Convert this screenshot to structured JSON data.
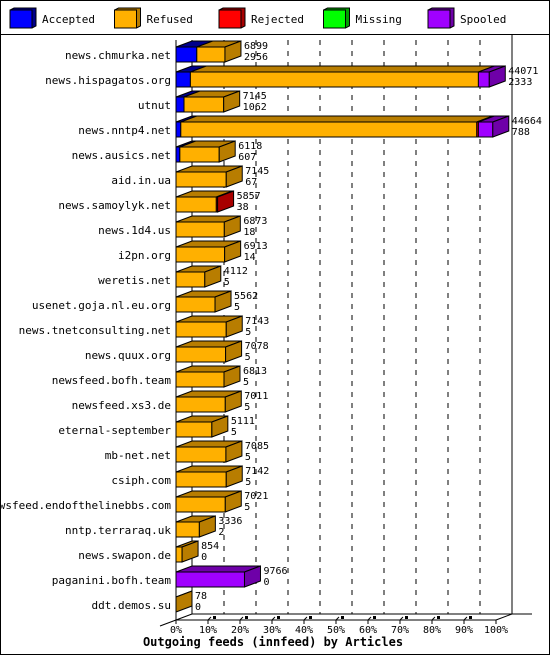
{
  "chart_data": {
    "type": "bar",
    "orientation": "horizontal",
    "stacked": true,
    "style": "3d",
    "title": "",
    "xlabel": "Outgoing feeds (innfeed) by Articles",
    "ylabel": "",
    "xlim": [
      0,
      100
    ],
    "x_ticks": [
      "0%",
      "10%",
      "20%",
      "30%",
      "40%",
      "50%",
      "60%",
      "70%",
      "80%",
      "90%",
      "100%"
    ],
    "grid": "vertical dashed",
    "legend_position": "top",
    "legend": [
      {
        "name": "Accepted",
        "color": "#0000ff",
        "side": "#00008b"
      },
      {
        "name": "Refused",
        "color": "#ffb000",
        "side": "#b87d00"
      },
      {
        "name": "Rejected",
        "color": "#ff0000",
        "side": "#a80000"
      },
      {
        "name": "Missing",
        "color": "#00ff00",
        "side": "#00a000"
      },
      {
        "name": "Spooled",
        "color": "#a000ff",
        "side": "#6e00a8"
      }
    ],
    "categories": [
      "news.chmurka.net",
      "news.hispagatos.org",
      "utnut",
      "news.nntp4.net",
      "news.ausics.net",
      "aid.in.ua",
      "news.samoylyk.net",
      "news.1d4.us",
      "i2pn.org",
      "weretis.net",
      "usenet.goja.nl.eu.org",
      "news.tnetconsulting.net",
      "news.quux.org",
      "newsfeed.bofh.team",
      "newsfeed.xs3.de",
      "eternal-september",
      "mb-net.net",
      "csiph.com",
      "newsfeed.endofthelinebbs.com",
      "nntp.terraraq.uk",
      "news.swapon.de",
      "paganini.bofh.team",
      "ddt.demos.su"
    ],
    "offered_labels": [
      6899,
      44071,
      7145,
      44664,
      6118,
      7145,
      5857,
      6873,
      6913,
      4112,
      5562,
      7143,
      7078,
      6813,
      7011,
      5111,
      7085,
      7142,
      7021,
      3336,
      854,
      9766,
      78
    ],
    "accepted_labels": [
      2956,
      2333,
      1062,
      788,
      607,
      67,
      38,
      18,
      14,
      5,
      5,
      5,
      5,
      5,
      5,
      5,
      5,
      5,
      5,
      2,
      0,
      0,
      0
    ],
    "series_percent": [
      {
        "name": "Accepted",
        "values": [
          6.5,
          4.5,
          2.5,
          1.5,
          1.2,
          0,
          0,
          0,
          0,
          0,
          0,
          0,
          0,
          0,
          0,
          0,
          0,
          0,
          0,
          0,
          0,
          0,
          0
        ]
      },
      {
        "name": "Refused",
        "values": [
          8.8,
          90.0,
          12.4,
          92.5,
          12.3,
          15.7,
          12.6,
          15.1,
          15.2,
          9.0,
          12.2,
          15.7,
          15.5,
          15.0,
          15.4,
          11.2,
          15.6,
          15.7,
          15.4,
          7.3,
          1.9,
          0,
          0
        ]
      },
      {
        "name": "Rejected",
        "values": [
          0,
          0,
          0,
          0.5,
          0,
          0,
          0.4,
          0,
          0,
          0,
          0,
          0,
          0,
          0,
          0,
          0,
          0,
          0,
          0,
          0,
          0,
          0,
          0
        ]
      },
      {
        "name": "Missing",
        "values": [
          0,
          0,
          0,
          0,
          0,
          0,
          0,
          0,
          0,
          0,
          0,
          0,
          0,
          0,
          0,
          0,
          0,
          0,
          0,
          0,
          0,
          0,
          0
        ]
      },
      {
        "name": "Spooled",
        "values": [
          0,
          3.4,
          0,
          4.5,
          0,
          0,
          0,
          0,
          0,
          0,
          0,
          0,
          0,
          0,
          0,
          0,
          0,
          0,
          0,
          0,
          0,
          21.4,
          0
        ]
      }
    ]
  }
}
